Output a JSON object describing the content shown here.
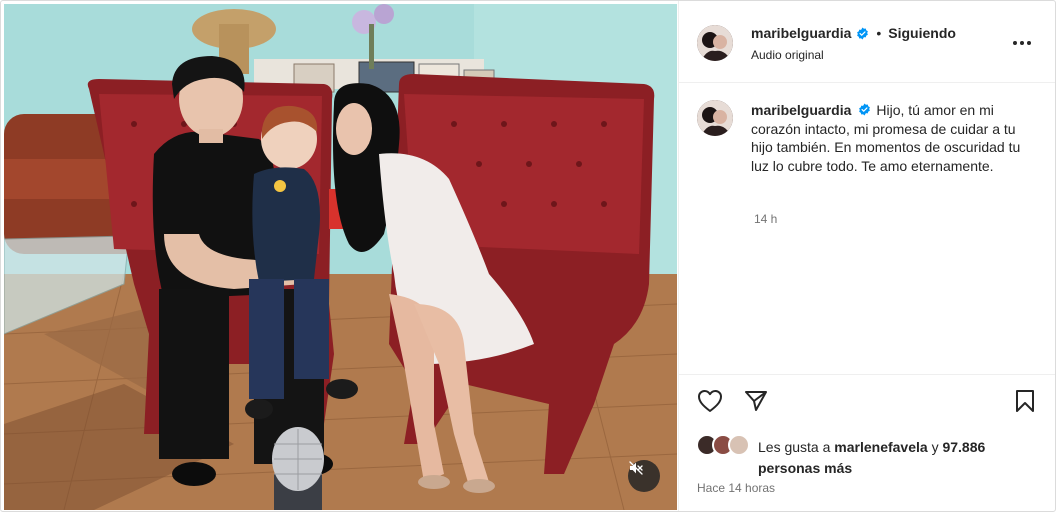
{
  "post": {
    "author": "maribelguardia",
    "follow_separator": "•",
    "follow_state": "Siguiendo",
    "audio_label": "Audio original",
    "caption_text": "Hijo, tú amor en mi corazón intacto, mi promesa de cuidar a tu hijo también. En momentos de oscuridad tu luz lo cubre todo. Te amo eternamente.",
    "caption_time": "14 h",
    "likes": {
      "prefix": "Les gusta a",
      "first_user": "marlenefavela",
      "connector": "y",
      "others": "97.886 personas más"
    },
    "post_time": "Hace 14 horas"
  },
  "icons": {
    "verified": "verified-badge-icon",
    "more": "more-options-icon",
    "like": "heart-icon",
    "share": "paper-plane-icon",
    "save": "bookmark-icon",
    "mute": "speaker-muted-icon"
  },
  "colors": {
    "verified_blue": "#0095f6",
    "secondary_text": "#737373",
    "primary_text": "#262626",
    "divider": "#efefef"
  }
}
